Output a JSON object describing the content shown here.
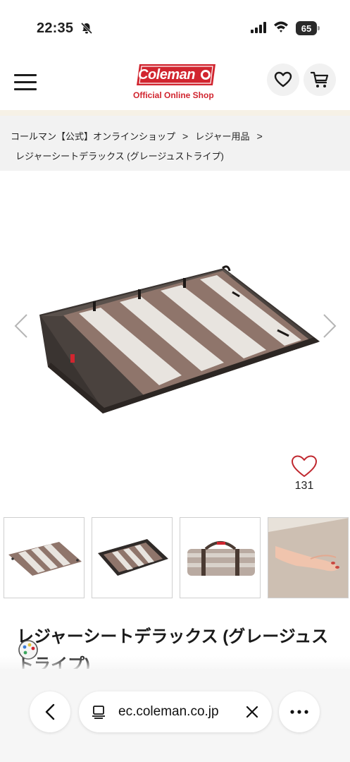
{
  "status_bar": {
    "time": "22:35",
    "battery_level": "65"
  },
  "header": {
    "logo_text": "Coleman",
    "logo_subtitle": "Official Online Shop",
    "brand_color": "#d1252f"
  },
  "breadcrumb": {
    "items": [
      "コールマン【公式】オンラインショップ",
      "レジャー用品"
    ],
    "separator": ">",
    "current": "レジャーシートデラックス (グレージュストライプ)"
  },
  "product": {
    "like_count": "131",
    "title": "レジャーシートデラックス (グレージュストライプ)"
  },
  "thumbnails": [
    {
      "name": "thumb-flat-sheet"
    },
    {
      "name": "thumb-sheet-angle"
    },
    {
      "name": "thumb-rolled-sheet"
    },
    {
      "name": "thumb-hand-detail"
    }
  ],
  "browser": {
    "url": "ec.coleman.co.jp"
  },
  "colors": {
    "accent": "#d1252f",
    "sheet_brown": "#8f756b",
    "sheet_stripe": "#e8e4df",
    "breadcrumb_bg": "#f2f2f2",
    "band": "#f6f1e6"
  }
}
